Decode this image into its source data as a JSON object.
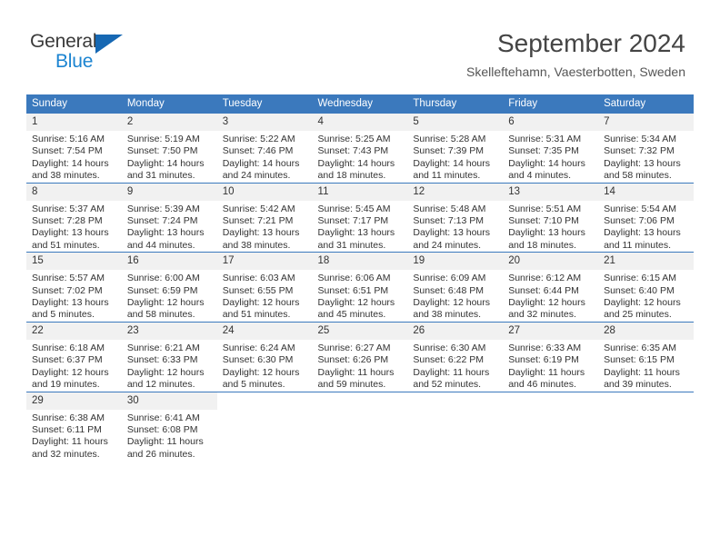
{
  "brand": {
    "name_part1": "General",
    "name_part2": "Blue",
    "accent_color": "#1b84d1",
    "triangle_color": "#1668b3"
  },
  "header": {
    "month_title": "September 2024",
    "location": "Skelleftehamn, Vaesterbotten, Sweden"
  },
  "calendar": {
    "header_bg": "#3b79bd",
    "daynum_bg": "#f1f1f1",
    "weekday_names": [
      "Sunday",
      "Monday",
      "Tuesday",
      "Wednesday",
      "Thursday",
      "Friday",
      "Saturday"
    ],
    "weeks": [
      [
        {
          "day": "1",
          "sunrise": "Sunrise: 5:16 AM",
          "sunset": "Sunset: 7:54 PM",
          "daylight_line1": "Daylight: 14 hours",
          "daylight_line2": "and 38 minutes."
        },
        {
          "day": "2",
          "sunrise": "Sunrise: 5:19 AM",
          "sunset": "Sunset: 7:50 PM",
          "daylight_line1": "Daylight: 14 hours",
          "daylight_line2": "and 31 minutes."
        },
        {
          "day": "3",
          "sunrise": "Sunrise: 5:22 AM",
          "sunset": "Sunset: 7:46 PM",
          "daylight_line1": "Daylight: 14 hours",
          "daylight_line2": "and 24 minutes."
        },
        {
          "day": "4",
          "sunrise": "Sunrise: 5:25 AM",
          "sunset": "Sunset: 7:43 PM",
          "daylight_line1": "Daylight: 14 hours",
          "daylight_line2": "and 18 minutes."
        },
        {
          "day": "5",
          "sunrise": "Sunrise: 5:28 AM",
          "sunset": "Sunset: 7:39 PM",
          "daylight_line1": "Daylight: 14 hours",
          "daylight_line2": "and 11 minutes."
        },
        {
          "day": "6",
          "sunrise": "Sunrise: 5:31 AM",
          "sunset": "Sunset: 7:35 PM",
          "daylight_line1": "Daylight: 14 hours",
          "daylight_line2": "and 4 minutes."
        },
        {
          "day": "7",
          "sunrise": "Sunrise: 5:34 AM",
          "sunset": "Sunset: 7:32 PM",
          "daylight_line1": "Daylight: 13 hours",
          "daylight_line2": "and 58 minutes."
        }
      ],
      [
        {
          "day": "8",
          "sunrise": "Sunrise: 5:37 AM",
          "sunset": "Sunset: 7:28 PM",
          "daylight_line1": "Daylight: 13 hours",
          "daylight_line2": "and 51 minutes."
        },
        {
          "day": "9",
          "sunrise": "Sunrise: 5:39 AM",
          "sunset": "Sunset: 7:24 PM",
          "daylight_line1": "Daylight: 13 hours",
          "daylight_line2": "and 44 minutes."
        },
        {
          "day": "10",
          "sunrise": "Sunrise: 5:42 AM",
          "sunset": "Sunset: 7:21 PM",
          "daylight_line1": "Daylight: 13 hours",
          "daylight_line2": "and 38 minutes."
        },
        {
          "day": "11",
          "sunrise": "Sunrise: 5:45 AM",
          "sunset": "Sunset: 7:17 PM",
          "daylight_line1": "Daylight: 13 hours",
          "daylight_line2": "and 31 minutes."
        },
        {
          "day": "12",
          "sunrise": "Sunrise: 5:48 AM",
          "sunset": "Sunset: 7:13 PM",
          "daylight_line1": "Daylight: 13 hours",
          "daylight_line2": "and 24 minutes."
        },
        {
          "day": "13",
          "sunrise": "Sunrise: 5:51 AM",
          "sunset": "Sunset: 7:10 PM",
          "daylight_line1": "Daylight: 13 hours",
          "daylight_line2": "and 18 minutes."
        },
        {
          "day": "14",
          "sunrise": "Sunrise: 5:54 AM",
          "sunset": "Sunset: 7:06 PM",
          "daylight_line1": "Daylight: 13 hours",
          "daylight_line2": "and 11 minutes."
        }
      ],
      [
        {
          "day": "15",
          "sunrise": "Sunrise: 5:57 AM",
          "sunset": "Sunset: 7:02 PM",
          "daylight_line1": "Daylight: 13 hours",
          "daylight_line2": "and 5 minutes."
        },
        {
          "day": "16",
          "sunrise": "Sunrise: 6:00 AM",
          "sunset": "Sunset: 6:59 PM",
          "daylight_line1": "Daylight: 12 hours",
          "daylight_line2": "and 58 minutes."
        },
        {
          "day": "17",
          "sunrise": "Sunrise: 6:03 AM",
          "sunset": "Sunset: 6:55 PM",
          "daylight_line1": "Daylight: 12 hours",
          "daylight_line2": "and 51 minutes."
        },
        {
          "day": "18",
          "sunrise": "Sunrise: 6:06 AM",
          "sunset": "Sunset: 6:51 PM",
          "daylight_line1": "Daylight: 12 hours",
          "daylight_line2": "and 45 minutes."
        },
        {
          "day": "19",
          "sunrise": "Sunrise: 6:09 AM",
          "sunset": "Sunset: 6:48 PM",
          "daylight_line1": "Daylight: 12 hours",
          "daylight_line2": "and 38 minutes."
        },
        {
          "day": "20",
          "sunrise": "Sunrise: 6:12 AM",
          "sunset": "Sunset: 6:44 PM",
          "daylight_line1": "Daylight: 12 hours",
          "daylight_line2": "and 32 minutes."
        },
        {
          "day": "21",
          "sunrise": "Sunrise: 6:15 AM",
          "sunset": "Sunset: 6:40 PM",
          "daylight_line1": "Daylight: 12 hours",
          "daylight_line2": "and 25 minutes."
        }
      ],
      [
        {
          "day": "22",
          "sunrise": "Sunrise: 6:18 AM",
          "sunset": "Sunset: 6:37 PM",
          "daylight_line1": "Daylight: 12 hours",
          "daylight_line2": "and 19 minutes."
        },
        {
          "day": "23",
          "sunrise": "Sunrise: 6:21 AM",
          "sunset": "Sunset: 6:33 PM",
          "daylight_line1": "Daylight: 12 hours",
          "daylight_line2": "and 12 minutes."
        },
        {
          "day": "24",
          "sunrise": "Sunrise: 6:24 AM",
          "sunset": "Sunset: 6:30 PM",
          "daylight_line1": "Daylight: 12 hours",
          "daylight_line2": "and 5 minutes."
        },
        {
          "day": "25",
          "sunrise": "Sunrise: 6:27 AM",
          "sunset": "Sunset: 6:26 PM",
          "daylight_line1": "Daylight: 11 hours",
          "daylight_line2": "and 59 minutes."
        },
        {
          "day": "26",
          "sunrise": "Sunrise: 6:30 AM",
          "sunset": "Sunset: 6:22 PM",
          "daylight_line1": "Daylight: 11 hours",
          "daylight_line2": "and 52 minutes."
        },
        {
          "day": "27",
          "sunrise": "Sunrise: 6:33 AM",
          "sunset": "Sunset: 6:19 PM",
          "daylight_line1": "Daylight: 11 hours",
          "daylight_line2": "and 46 minutes."
        },
        {
          "day": "28",
          "sunrise": "Sunrise: 6:35 AM",
          "sunset": "Sunset: 6:15 PM",
          "daylight_line1": "Daylight: 11 hours",
          "daylight_line2": "and 39 minutes."
        }
      ],
      [
        {
          "day": "29",
          "sunrise": "Sunrise: 6:38 AM",
          "sunset": "Sunset: 6:11 PM",
          "daylight_line1": "Daylight: 11 hours",
          "daylight_line2": "and 32 minutes."
        },
        {
          "day": "30",
          "sunrise": "Sunrise: 6:41 AM",
          "sunset": "Sunset: 6:08 PM",
          "daylight_line1": "Daylight: 11 hours",
          "daylight_line2": "and 26 minutes."
        },
        {
          "day": "",
          "sunrise": "",
          "sunset": "",
          "daylight_line1": "",
          "daylight_line2": ""
        },
        {
          "day": "",
          "sunrise": "",
          "sunset": "",
          "daylight_line1": "",
          "daylight_line2": ""
        },
        {
          "day": "",
          "sunrise": "",
          "sunset": "",
          "daylight_line1": "",
          "daylight_line2": ""
        },
        {
          "day": "",
          "sunrise": "",
          "sunset": "",
          "daylight_line1": "",
          "daylight_line2": ""
        },
        {
          "day": "",
          "sunrise": "",
          "sunset": "",
          "daylight_line1": "",
          "daylight_line2": ""
        }
      ]
    ]
  }
}
